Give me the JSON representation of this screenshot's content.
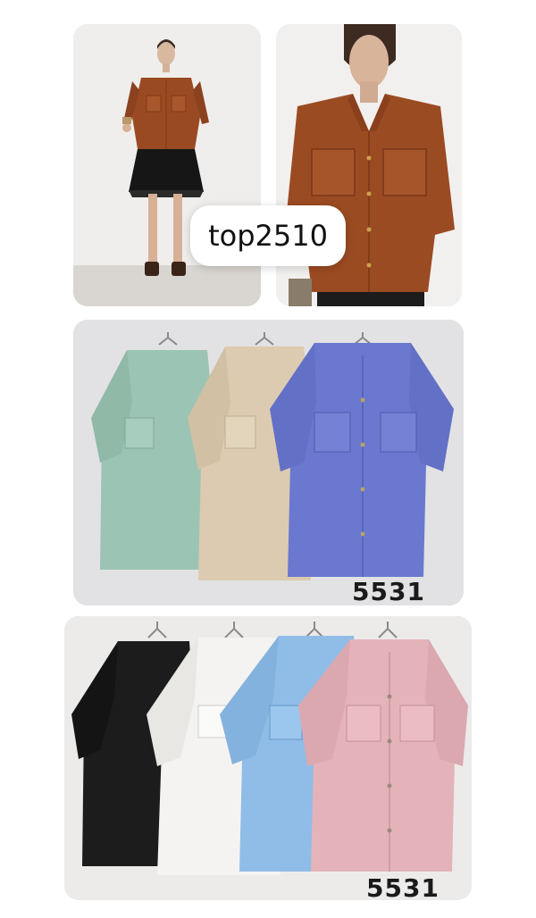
{
  "collage": {
    "tag": "top2510",
    "photo_left": {
      "subject": "model wearing rust brown utility shirt with black fringe skirt"
    },
    "photo_right": {
      "subject": "close-up of rust brown utility shirt with button-tab sleeves"
    },
    "row1": {
      "code": "5531",
      "shirts": [
        {
          "color_name": "mint green",
          "hex": "#9cc4b4"
        },
        {
          "color_name": "beige",
          "hex": "#dccbb0"
        },
        {
          "color_name": "periwinkle blue",
          "hex": "#6a78cf"
        }
      ]
    },
    "row2": {
      "code": "5531",
      "shirts": [
        {
          "color_name": "black",
          "hex": "#1c1c1c"
        },
        {
          "color_name": "white",
          "hex": "#f4f3f1"
        },
        {
          "color_name": "sky blue",
          "hex": "#8fbde8"
        },
        {
          "color_name": "pink",
          "hex": "#e4b3ba"
        }
      ]
    }
  }
}
